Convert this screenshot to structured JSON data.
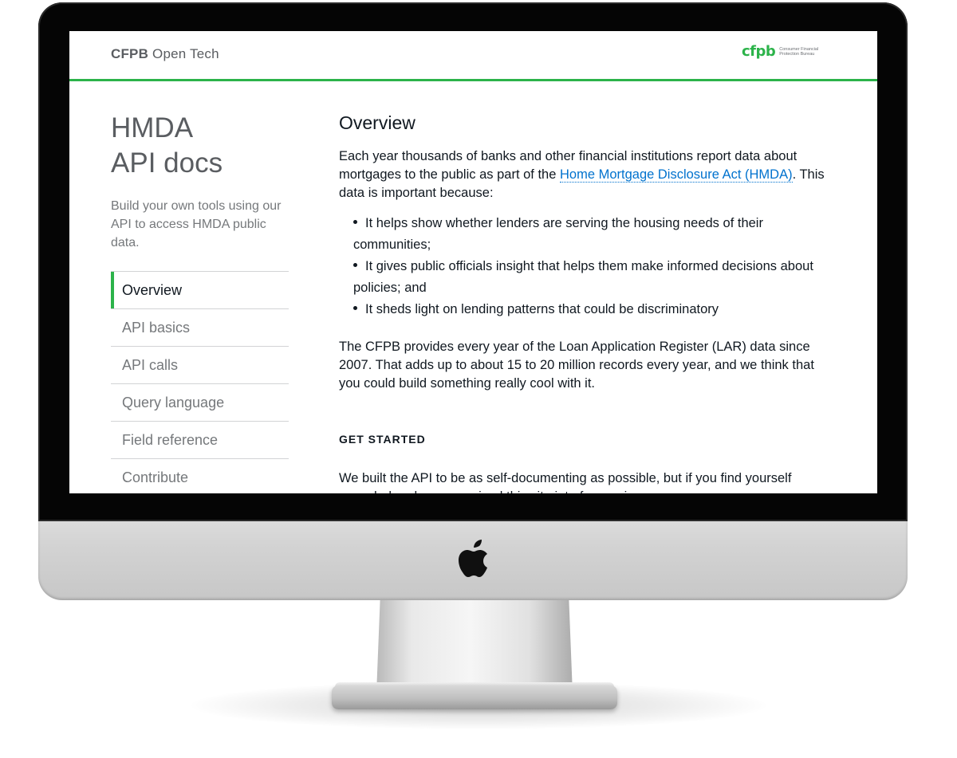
{
  "header": {
    "brand_bold": "CFPB",
    "brand_light": "Open Tech",
    "logo_mark": "cfpb",
    "logo_words": "Consumer Financial Protection Bureau"
  },
  "sidebar": {
    "title": "HMDA\nAPI docs",
    "description": "Build your own tools using our API to access HMDA public data.",
    "nav": [
      {
        "label": "Overview",
        "active": true
      },
      {
        "label": "API basics",
        "active": false
      },
      {
        "label": "API calls",
        "active": false
      },
      {
        "label": "Query language",
        "active": false
      },
      {
        "label": "Field reference",
        "active": false
      },
      {
        "label": "Contribute",
        "active": false
      }
    ]
  },
  "main": {
    "title": "Overview",
    "intro_before": "Each year thousands of banks and other financial institutions report data about mortgages to the public as part of the ",
    "intro_link": "Home Mortgage Disclosure Act (HMDA)",
    "intro_after": ". This data is important because:",
    "bullets": [
      "It helps show whether lenders are serving the housing needs of their communities;",
      "It gives public officials insight that helps them make informed decisions about policies; and",
      "It sheds light on lending patterns that could be discriminatory"
    ],
    "para2": "The CFPB provides every year of the Loan Application Register (LAR) data since 2007. That adds up to about 15 to 20 million records every year, and we think that you could build something really cool with it.",
    "get_started_heading": "GET STARTED",
    "para3": "We built the API to be as self-documenting as possible, but if you find yourself overwhelmed, we organized this site into four major areas."
  },
  "colors": {
    "accent_green": "#2cb34a",
    "link_blue": "#0072ce"
  },
  "icons": {
    "device_logo": "apple-logo-icon"
  }
}
